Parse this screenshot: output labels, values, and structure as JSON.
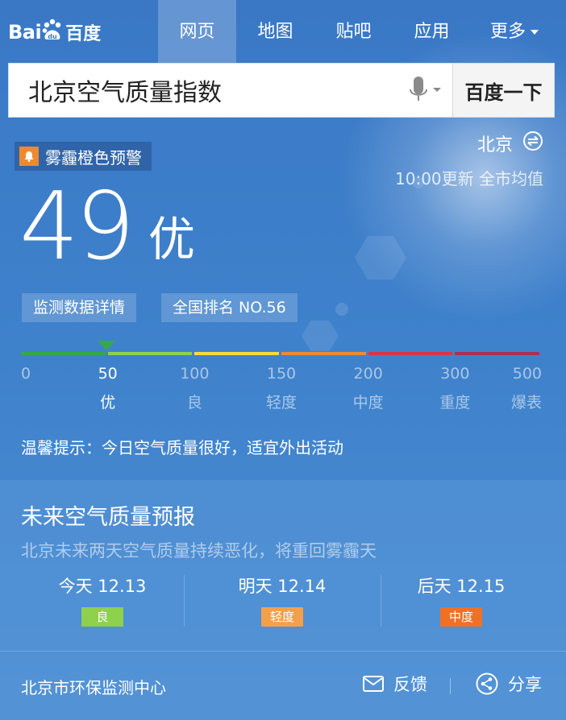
{
  "header": {
    "logo_text": "Bai",
    "logo_cn": "百度",
    "tabs": [
      {
        "label": "网页"
      },
      {
        "label": "地图"
      },
      {
        "label": "贴吧"
      },
      {
        "label": "应用"
      }
    ],
    "more_label": "更多"
  },
  "search": {
    "query": "北京空气质量指数",
    "button_label": "百度一下"
  },
  "air": {
    "warning": "雾霾橙色预警",
    "city": "北京",
    "update_text": "10:00更新 全市均值",
    "aqi_value": "49",
    "aqi_level": "优",
    "detail_link": "监测数据详情",
    "rank_label": "全国排名 NO.56",
    "marker_value": 49,
    "scale": {
      "ticks": [
        "0",
        "50",
        "100",
        "150",
        "200",
        "300",
        "500"
      ],
      "levels": [
        "优",
        "良",
        "轻度",
        "中度",
        "重度",
        "爆表"
      ],
      "colors": [
        "#35a94a",
        "#8dd14c",
        "#f3dc3c",
        "#ee8a33",
        "#d8354a",
        "#a8305f"
      ]
    },
    "tip": "温馨提示：今日空气质量很好，适宜外出活动"
  },
  "forecast": {
    "title": "未来空气质量预报",
    "subtitle": "北京未来两天空气质量持续恶化，将重回雾霾天",
    "days": [
      {
        "date": "今天 12.13",
        "level": "良",
        "color": "#8dd14c"
      },
      {
        "date": "明天 12.14",
        "level": "轻度",
        "color": "#f4a04b"
      },
      {
        "date": "后天 12.15",
        "level": "中度",
        "color": "#f07025"
      }
    ]
  },
  "footer": {
    "source": "北京市环保监测中心",
    "feedback_label": "反馈",
    "share_label": "分享"
  }
}
